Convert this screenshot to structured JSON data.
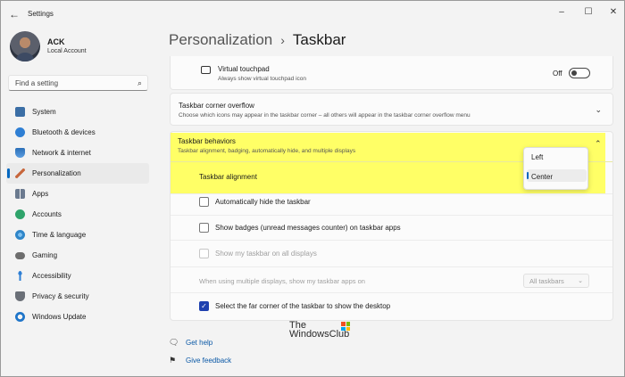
{
  "window": {
    "title": "Settings",
    "controls": [
      "–",
      "☐",
      "✕"
    ]
  },
  "user": {
    "name": "ACK",
    "account": "Local Account"
  },
  "search": {
    "placeholder": "Find a setting"
  },
  "nav": [
    {
      "label": "System",
      "icon": "monitor-icon",
      "color": "#3b6ea5"
    },
    {
      "label": "Bluetooth & devices",
      "icon": "bluetooth-icon",
      "color": "#2f7fd4"
    },
    {
      "label": "Network & internet",
      "icon": "network-icon",
      "color": "#2c6fb8"
    },
    {
      "label": "Personalization",
      "icon": "brush-icon",
      "color": "#c7663b",
      "active": true
    },
    {
      "label": "Apps",
      "icon": "apps-icon",
      "color": "#6b7a8f"
    },
    {
      "label": "Accounts",
      "icon": "accounts-icon",
      "color": "#2ea36a"
    },
    {
      "label": "Time & language",
      "icon": "globe-icon",
      "color": "#2f86c9"
    },
    {
      "label": "Gaming",
      "icon": "gaming-icon",
      "color": "#6d6d6d"
    },
    {
      "label": "Accessibility",
      "icon": "accessibility-icon",
      "color": "#2f7fd4"
    },
    {
      "label": "Privacy & security",
      "icon": "shield-icon",
      "color": "#6a6f77"
    },
    {
      "label": "Windows Update",
      "icon": "update-icon",
      "color": "#1f75c9"
    }
  ],
  "breadcrumb": {
    "parent": "Personalization",
    "separator": "›",
    "current": "Taskbar"
  },
  "virtual_touchpad": {
    "title": "Virtual touchpad",
    "subtitle": "Always show virtual touchpad icon",
    "state": "Off"
  },
  "corner_overflow": {
    "title": "Taskbar corner overflow",
    "subtitle": "Choose which icons may appear in the taskbar corner – all others will appear in the taskbar corner overflow menu"
  },
  "behaviors": {
    "title": "Taskbar behaviors",
    "subtitle": "Taskbar alignment, badging, automatically hide, and multiple displays",
    "alignment_label": "Taskbar alignment",
    "alignment_options": [
      "Left",
      "Center"
    ],
    "alignment_selected": "Center",
    "auto_hide": "Automatically hide the taskbar",
    "badges": "Show badges (unread messages counter) on taskbar apps",
    "all_displays": "Show my taskbar on all displays",
    "multi_display_label": "When using multiple displays, show my taskbar apps on",
    "multi_display_value": "All taskbars",
    "far_corner": "Select the far corner of the taskbar to show the desktop"
  },
  "footer": {
    "help": "Get help",
    "feedback": "Give feedback"
  },
  "watermark": {
    "line1": "The",
    "line2": "WindowsClub"
  },
  "colors": {
    "accent": "#0067c0",
    "highlight": "#ffff66"
  }
}
